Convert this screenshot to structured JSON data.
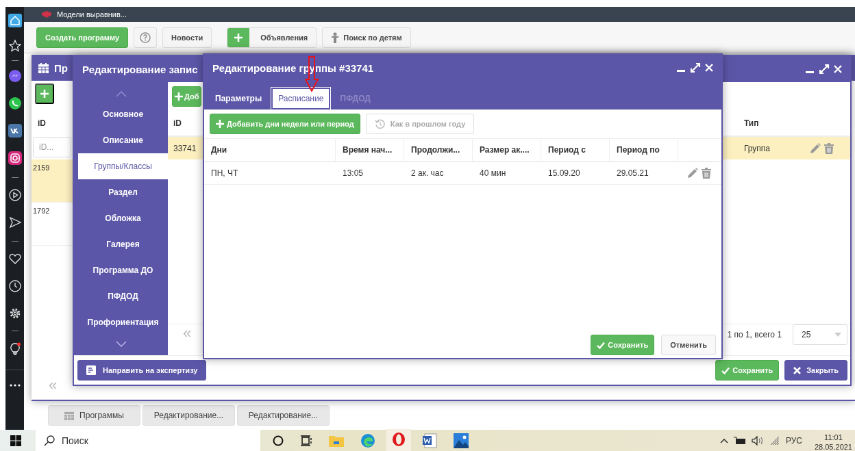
{
  "browser": {
    "tab_title": "Модели выравнив..."
  },
  "toolbar": {
    "buttons": [
      {
        "kind": "primary",
        "label": "Создать программу"
      },
      {
        "kind": "help"
      },
      {
        "kind": "plain",
        "label": "Новости"
      },
      {
        "kind": "add",
        "label": "Объявления"
      },
      {
        "kind": "person",
        "label": "Поиск по детям"
      }
    ]
  },
  "window_programs": {
    "title": "Пр",
    "columns": [
      "iD"
    ],
    "filter_placeholder": "iD...",
    "rows": [
      {
        "id": "2159",
        "selected": true
      },
      {
        "id": "1792",
        "selected": false
      }
    ],
    "pager_first": "«"
  },
  "window_record": {
    "title": "Редактирование запис",
    "nav": [
      {
        "label": "Основное",
        "selected": false
      },
      {
        "label": "Описание",
        "selected": false
      },
      {
        "label": "Группы/Классы",
        "selected": true
      },
      {
        "label": "Раздел",
        "selected": false
      },
      {
        "label": "Обложка",
        "selected": false
      },
      {
        "label": "Галерея",
        "selected": false
      },
      {
        "label": "Программа ДО",
        "selected": false
      },
      {
        "label": "ПФДОД",
        "selected": false
      },
      {
        "label": "Профориентация",
        "selected": false
      }
    ],
    "add_button": "Доб",
    "columns": [
      "iD",
      "Тип"
    ],
    "rows": [
      {
        "id": "33741",
        "type": "Группа",
        "selected": true
      }
    ],
    "pager_first": "«",
    "pager_info": "1 по 1, всего 1",
    "page_size": "25",
    "send_button": "Направить на экспертизу",
    "save_button": "Сохранить",
    "close_button": "Закрыть"
  },
  "window_group": {
    "title": "Редактирование группы #33741",
    "tabs": [
      {
        "label": "Параметры",
        "selected": false,
        "disabled": false
      },
      {
        "label": "Расписание",
        "selected": true,
        "disabled": false
      },
      {
        "label": "ПФДОД",
        "selected": false,
        "disabled": true
      }
    ],
    "add_button": "Добавить дни недели или период",
    "copy_button": {
      "label": "Как в прошлом году",
      "disabled": true
    },
    "columns": [
      "Дни",
      "Время нач...",
      "Продолжи...",
      "Размер ак....",
      "Период с",
      "Период по"
    ],
    "rows": [
      {
        "cells": [
          "ПН, ЧТ",
          "13:05",
          "2 ак. час",
          "40 мин",
          "15.09.20",
          "29.05.21"
        ]
      }
    ],
    "save_button": "Сохранить",
    "cancel_button": "Отменить"
  },
  "app_tabs": [
    {
      "kind": "calendar",
      "label": "Программы"
    },
    {
      "kind": "plain",
      "label": "Редактирование..."
    },
    {
      "kind": "plain",
      "label": "Редактирование..."
    }
  ],
  "taskbar": {
    "search_placeholder": "Поиск",
    "language": "РУС",
    "time": "11:01",
    "date": "28.05.2021"
  }
}
